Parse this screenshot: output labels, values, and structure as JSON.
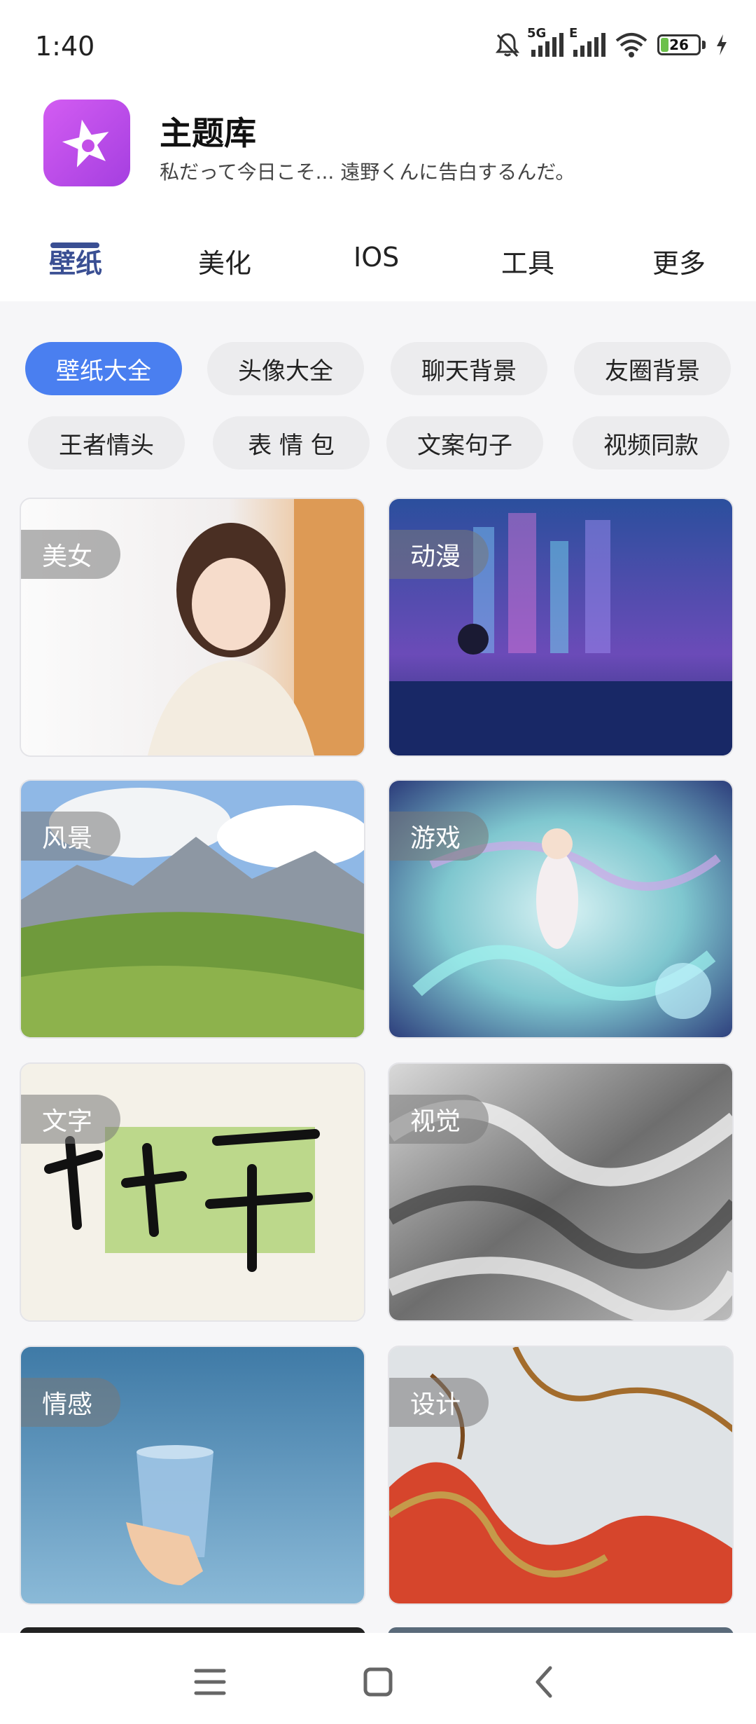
{
  "status": {
    "time": "1:40",
    "network1": "5G",
    "network2": "E",
    "battery": "26"
  },
  "header": {
    "title": "主题库",
    "subtitle": "私だって今日こそ... 遠野くんに告白するんだ。"
  },
  "tabs": [
    {
      "label": "壁纸",
      "active": true
    },
    {
      "label": "美化"
    },
    {
      "label": "IOS"
    },
    {
      "label": "工具"
    },
    {
      "label": "更多"
    }
  ],
  "chips": [
    {
      "label": "壁纸大全",
      "active": true
    },
    {
      "label": "头像大全"
    },
    {
      "label": "聊天背景"
    },
    {
      "label": "友圈背景"
    },
    {
      "label": "王者情头"
    },
    {
      "label": "表 情 包"
    },
    {
      "label": "文案句子"
    },
    {
      "label": "视频同款"
    }
  ],
  "cards": [
    {
      "label": "美女"
    },
    {
      "label": "动漫"
    },
    {
      "label": "风景"
    },
    {
      "label": "游戏"
    },
    {
      "label": "文字"
    },
    {
      "label": "视觉"
    },
    {
      "label": "情感"
    },
    {
      "label": "设计"
    }
  ],
  "colors": {
    "accent": "#4a7ff0",
    "tab_active": "#3a4f93",
    "app_icon": "#c34ee8"
  },
  "icons": {
    "app": "star-icon",
    "status": [
      "mute-bell-icon",
      "signal-icon",
      "wifi-icon",
      "battery-icon"
    ],
    "nav": [
      "menu-icon",
      "home-square-icon",
      "back-chevron-icon"
    ]
  }
}
